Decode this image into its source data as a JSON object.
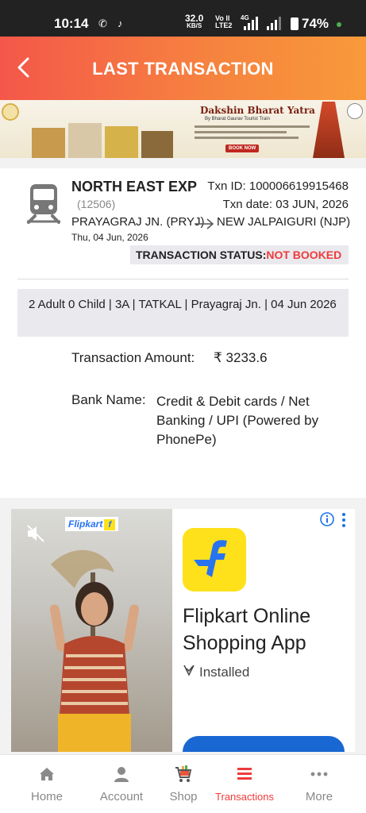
{
  "status_bar": {
    "time": "10:14",
    "speed_value": "32.0",
    "speed_unit": "KB/S",
    "network_label_top": "Vo ⁣ll",
    "network_label_bottom": "LTE2",
    "network_type": "4G",
    "battery": "74%"
  },
  "header": {
    "title": "LAST TRANSACTION",
    "back_icon": "back-arrow-icon"
  },
  "banner": {
    "title": "Dakshin Bharat Yatra",
    "subtitle": "By Bharat Gaurav Tourist Train",
    "cta": "BOOK NOW"
  },
  "transaction": {
    "train_name": "NORTH EAST EXP",
    "train_number": "(12506)",
    "txn_id": "Txn ID: 100006619915468",
    "txn_date": "Txn date: 03 JUN, 2026",
    "from_station": "PRAYAGRAJ JN. (PRYJ)",
    "to_station": "NEW JALPAIGURI (NJP)",
    "journey_date": "Thu, 04 Jun, 2026",
    "status_label": "TRANSACTION STATUS:",
    "status_value": "NOT BOOKED",
    "details": "2 Adult 0 Child  | 3A | TATKAL | Prayagraj Jn. | 04 Jun 2026",
    "amount_label": "Transaction Amount:",
    "amount_value": "₹  3233.6",
    "bank_label": "Bank Name:",
    "bank_value": "Credit & Debit cards / Net Banking / UPI (Powered by PhonePe)"
  },
  "ad": {
    "brand_tag": "Flipkart",
    "app_name": "Flipkart Online Shopping App",
    "install_status": "Installed"
  },
  "bottom_nav": {
    "items": [
      {
        "label": "Home",
        "icon": "home-icon"
      },
      {
        "label": "Account",
        "icon": "account-icon"
      },
      {
        "label": "Shop",
        "icon": "cart-icon"
      },
      {
        "label": "Transactions",
        "icon": "transactions-icon",
        "active": true
      },
      {
        "label": "More",
        "icon": "more-icon"
      }
    ]
  },
  "colors": {
    "header_gradient_start": "#f4574a",
    "header_gradient_end": "#f89a3a",
    "status_error": "#ef3b3b",
    "flipkart_blue": "#2874f0",
    "flipkart_yellow": "#ffe11b"
  }
}
